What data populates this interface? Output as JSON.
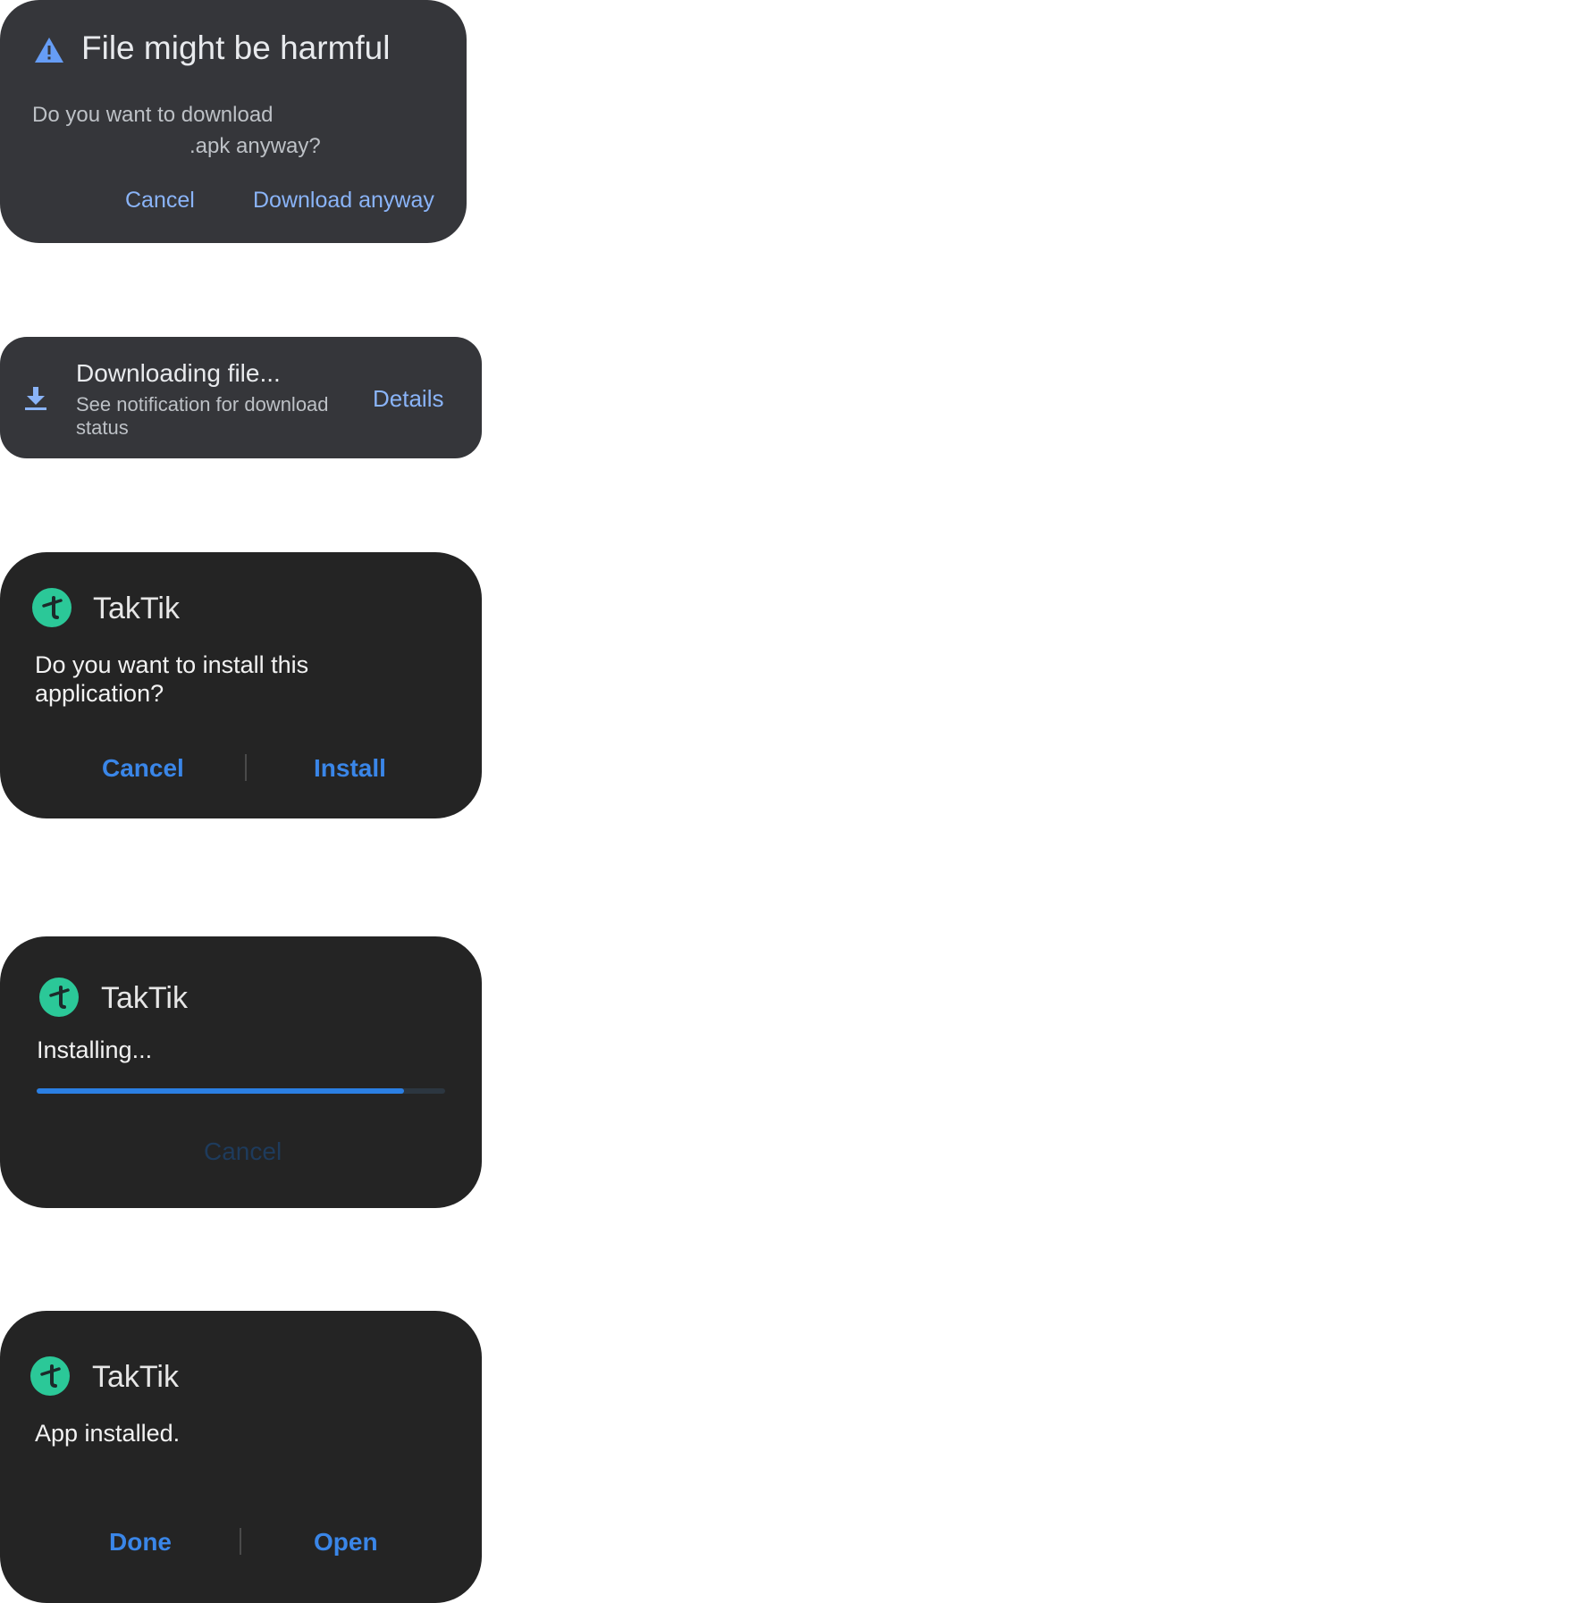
{
  "harmful_dialog": {
    "title": "File might be harmful",
    "message_line1": "Do you want to download",
    "message_line2": ".apk anyway?",
    "cancel_label": "Cancel",
    "download_label": "Download anyway",
    "icon": "warning-triangle-icon",
    "accent_color": "#8ab4f8"
  },
  "download_snackbar": {
    "title": "Downloading file...",
    "subtitle": "See notification for download status",
    "details_label": "Details",
    "icon": "download-icon"
  },
  "install_prompt": {
    "app_name": "TakTik",
    "message": "Do you want to install this application?",
    "cancel_label": "Cancel",
    "install_label": "Install",
    "icon": "app-icon"
  },
  "installing": {
    "app_name": "TakTik",
    "message": "Installing...",
    "progress": 0.9,
    "cancel_label": "Cancel"
  },
  "installed": {
    "app_name": "TakTik",
    "message": "App installed.",
    "done_label": "Done",
    "open_label": "Open"
  },
  "colors": {
    "samsung_accent": "#3a86e8",
    "app_icon_bg": "#2bc898"
  }
}
